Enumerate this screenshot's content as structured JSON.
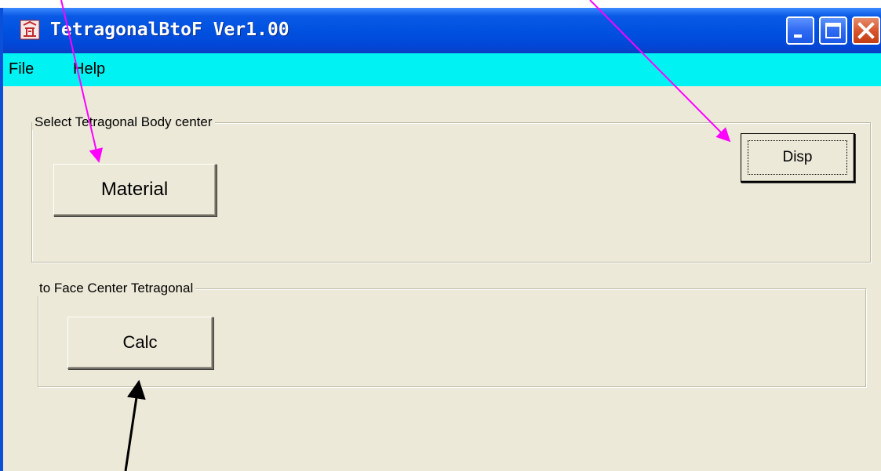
{
  "window": {
    "title": "TetragonalBtoF Ver1.00",
    "icon": "app-logo-icon",
    "controls": [
      "minimize-icon",
      "maximize-icon",
      "close-icon"
    ]
  },
  "menu": {
    "items": [
      "File",
      "Help"
    ]
  },
  "group_body_center": {
    "legend": "Select Tetragonal Body center",
    "material_button": "Material",
    "disp_button": "Disp"
  },
  "group_face_center": {
    "legend": "to Face Center Tetragonal",
    "calc_button": "Calc"
  },
  "annotations": {
    "arrow_color_magenta": "#ff00ff",
    "arrow_color_black": "#000000"
  },
  "colors": {
    "titlebar": "#0050e0",
    "menubar": "#00f2f2",
    "window_bg": "#ece9d8"
  }
}
